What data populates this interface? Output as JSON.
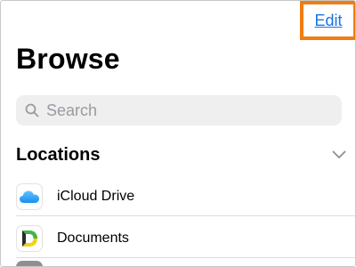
{
  "header": {
    "edit_label": "Edit"
  },
  "page": {
    "title": "Browse"
  },
  "search": {
    "placeholder": "Search",
    "value": ""
  },
  "locations": {
    "title": "Locations",
    "items": [
      {
        "label": "iCloud Drive",
        "icon": "icloud-icon"
      },
      {
        "label": "Documents",
        "icon": "documents-app-icon"
      }
    ]
  },
  "colors": {
    "highlight_border": "#f07d12",
    "link": "#1a74e8",
    "search_bg": "#efeff0"
  }
}
